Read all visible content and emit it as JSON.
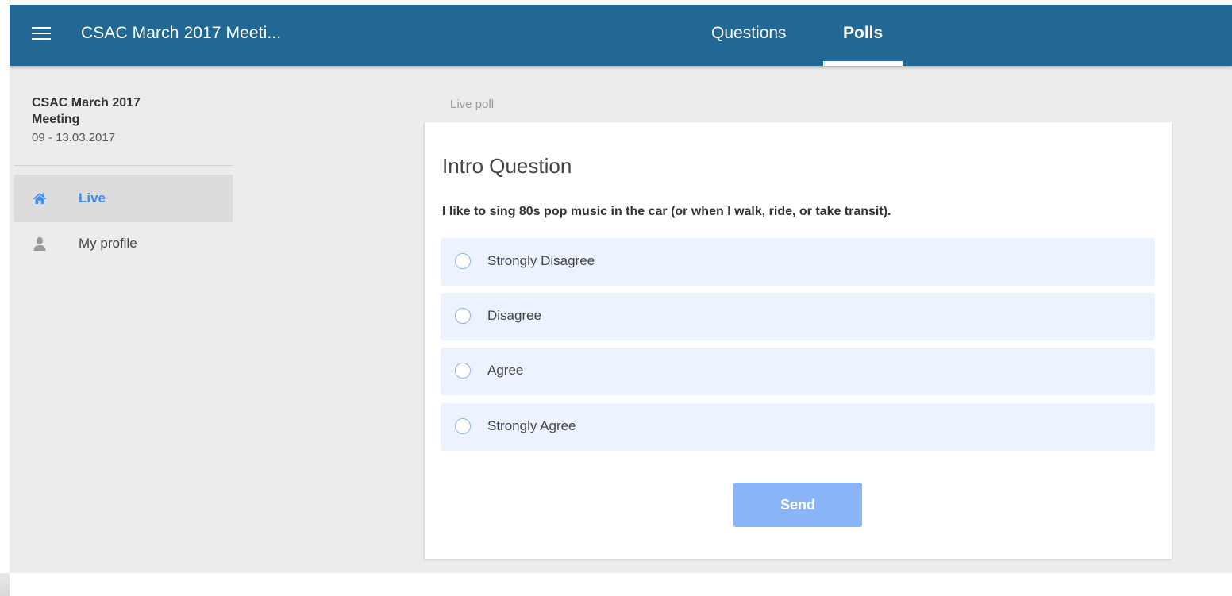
{
  "app": {
    "title": "CSAC March 2017 Meeti...",
    "menu_icon": "hamburger-menu-icon"
  },
  "tabs": [
    {
      "label": "Questions",
      "active": false
    },
    {
      "label": "Polls",
      "active": true
    }
  ],
  "sidebar": {
    "event_name": "CSAC March 2017 Meeting",
    "event_dates": "09 - 13.03.2017",
    "items": [
      {
        "label": "Live",
        "icon": "home-icon",
        "active": true
      },
      {
        "label": "My profile",
        "icon": "user-icon",
        "active": false
      }
    ]
  },
  "main": {
    "section_label": "Live poll",
    "poll": {
      "title": "Intro Question",
      "question": "I like to sing 80s pop music in the car (or when I walk, ride, or take transit).",
      "options": [
        {
          "label": "Strongly Disagree",
          "selected": false
        },
        {
          "label": "Disagree",
          "selected": false
        },
        {
          "label": "Agree",
          "selected": false
        },
        {
          "label": "Strongly Agree",
          "selected": false
        }
      ],
      "submit_label": "Send"
    }
  },
  "colors": {
    "topbar": "#226895",
    "accent": "#3f8ef0",
    "option_bg": "#ecf3ff",
    "send_button": "#8ab4f8",
    "page_bg": "#ececec"
  }
}
